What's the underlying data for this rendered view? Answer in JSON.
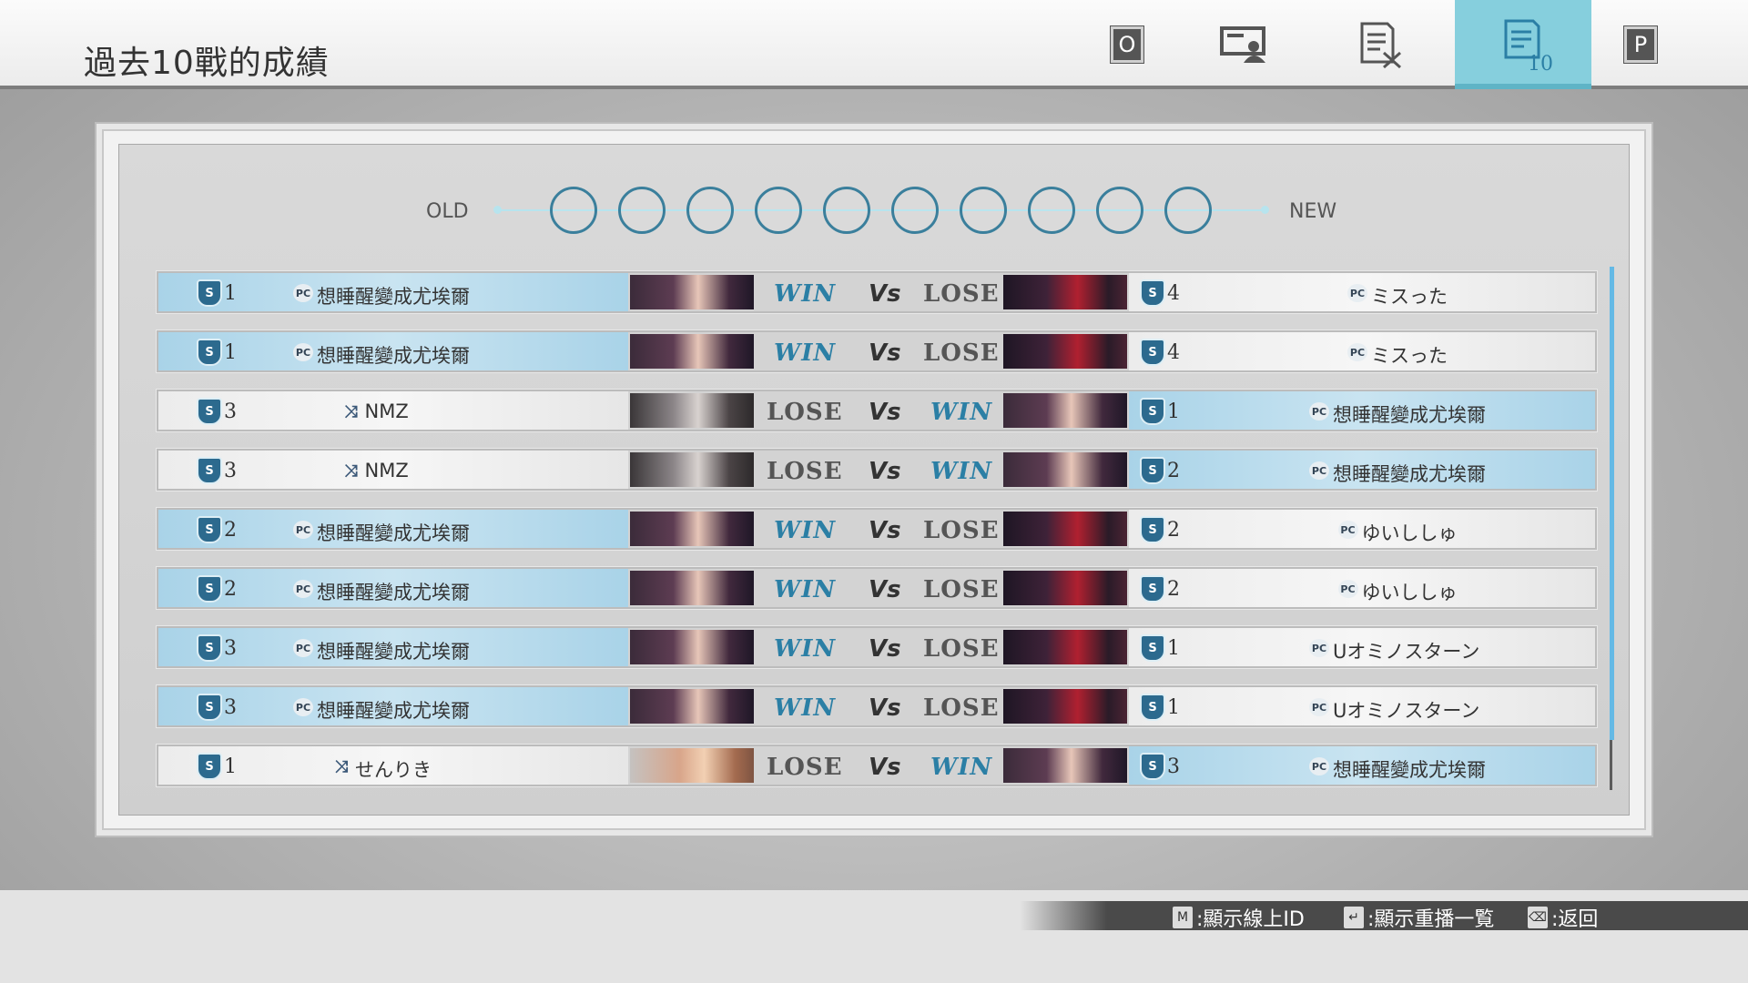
{
  "header": {
    "title": "過去10戰的成績",
    "tabs": [
      {
        "name": "tab-o",
        "key": "O"
      },
      {
        "name": "tab-player-card",
        "icon": "player-card-icon"
      },
      {
        "name": "tab-stats-edit",
        "icon": "edit-stats-icon"
      },
      {
        "name": "tab-last10",
        "icon": "record-list-icon",
        "badge": "10",
        "active": true
      },
      {
        "name": "tab-p",
        "key": "P"
      }
    ]
  },
  "timeline": {
    "old_label": "OLD",
    "new_label": "NEW",
    "slots": 10
  },
  "vs_label": "Vs",
  "matches": [
    {
      "left": {
        "rank": "1",
        "tag": "PC",
        "name": "想睡醒變成尤埃爾",
        "result": "WIN"
      },
      "right": {
        "rank": "4",
        "tag": "PC",
        "name": "ミスった",
        "result": "LOSE"
      }
    },
    {
      "left": {
        "rank": "1",
        "tag": "PC",
        "name": "想睡醒變成尤埃爾",
        "result": "WIN"
      },
      "right": {
        "rank": "4",
        "tag": "PC",
        "name": "ミスった",
        "result": "LOSE"
      }
    },
    {
      "left": {
        "rank": "3",
        "tag": "⤨",
        "name": "NMZ",
        "result": "LOSE"
      },
      "right": {
        "rank": "1",
        "tag": "PC",
        "name": "想睡醒變成尤埃爾",
        "result": "WIN"
      }
    },
    {
      "left": {
        "rank": "3",
        "tag": "⤨",
        "name": "NMZ",
        "result": "LOSE"
      },
      "right": {
        "rank": "2",
        "tag": "PC",
        "name": "想睡醒變成尤埃爾",
        "result": "WIN"
      }
    },
    {
      "left": {
        "rank": "2",
        "tag": "PC",
        "name": "想睡醒變成尤埃爾",
        "result": "WIN"
      },
      "right": {
        "rank": "2",
        "tag": "PC",
        "name": "ゆいししゅ",
        "result": "LOSE"
      }
    },
    {
      "left": {
        "rank": "2",
        "tag": "PC",
        "name": "想睡醒變成尤埃爾",
        "result": "WIN"
      },
      "right": {
        "rank": "2",
        "tag": "PC",
        "name": "ゆいししゅ",
        "result": "LOSE"
      }
    },
    {
      "left": {
        "rank": "3",
        "tag": "PC",
        "name": "想睡醒變成尤埃爾",
        "result": "WIN"
      },
      "right": {
        "rank": "1",
        "tag": "PC",
        "name": "Uオミノスターン",
        "result": "LOSE"
      }
    },
    {
      "left": {
        "rank": "3",
        "tag": "PC",
        "name": "想睡醒變成尤埃爾",
        "result": "WIN"
      },
      "right": {
        "rank": "1",
        "tag": "PC",
        "name": "Uオミノスターン",
        "result": "LOSE"
      }
    },
    {
      "left": {
        "rank": "1",
        "tag": "⤨",
        "name": "せんりき",
        "result": "LOSE"
      },
      "right": {
        "rank": "3",
        "tag": "PC",
        "name": "想睡醒變成尤埃爾",
        "result": "WIN"
      }
    }
  ],
  "footer": {
    "hints": [
      {
        "key": "M",
        "label": ":顯示線上ID"
      },
      {
        "key": "↵",
        "label": ":顯示重播一覧"
      },
      {
        "key": "⌫",
        "label": ":返回"
      }
    ]
  }
}
